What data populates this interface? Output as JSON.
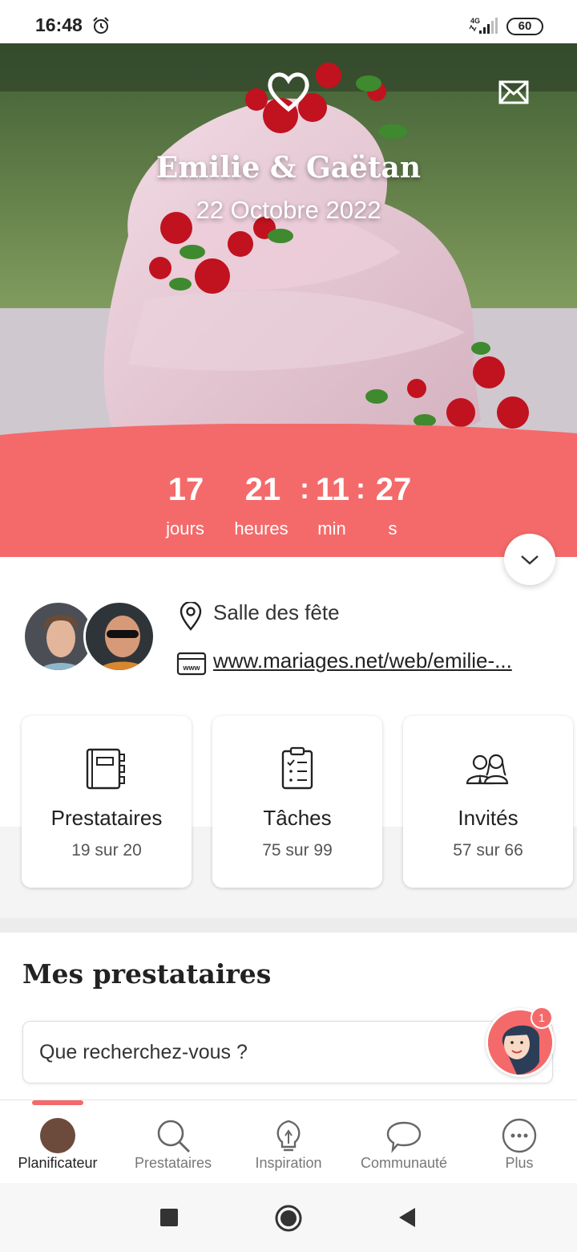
{
  "status_bar": {
    "time": "16:48",
    "network": "4G",
    "battery": "60"
  },
  "hero": {
    "couple": "Emilie & Gaëtan",
    "date": "22 Octobre 2022"
  },
  "countdown": {
    "days": "17",
    "days_label": "jours",
    "hours": "21",
    "hours_label": "heures",
    "minutes": "11",
    "minutes_label": "min",
    "seconds": "27",
    "seconds_label": "s",
    "separator": ":"
  },
  "info": {
    "location": "Salle des fête",
    "website": "www.mariages.net/web/emilie-...",
    "website_icon_text": "www"
  },
  "cards": [
    {
      "title": "Prestataires",
      "count": "19 sur 20",
      "icon": "notebook-icon"
    },
    {
      "title": "Tâches",
      "count": "75 sur 99",
      "icon": "checklist-icon"
    },
    {
      "title": "Invités",
      "count": "57 sur 66",
      "icon": "guests-icon"
    }
  ],
  "section": {
    "title": "Mes prestataires",
    "search_placeholder": "Que recherchez-vous ?"
  },
  "assistant": {
    "badge": "1"
  },
  "nav": [
    {
      "label": "Planificateur",
      "icon": "avatar",
      "active": true
    },
    {
      "label": "Prestataires",
      "icon": "search-icon"
    },
    {
      "label": "Inspiration",
      "icon": "lightbulb-icon"
    },
    {
      "label": "Communauté",
      "icon": "chat-bubble-icon"
    },
    {
      "label": "Plus",
      "icon": "more-icon"
    }
  ],
  "colors": {
    "accent": "#f46a6a",
    "text": "#222222"
  }
}
